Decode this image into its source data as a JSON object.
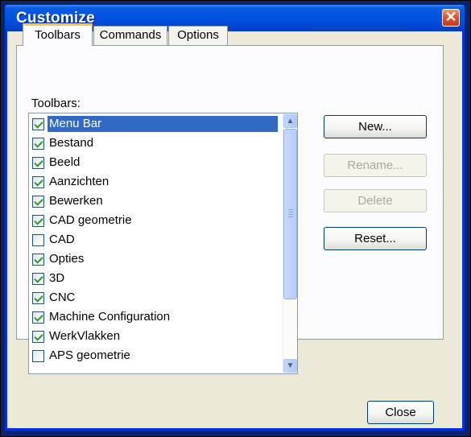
{
  "window": {
    "title": "Customize",
    "close_glyph": "✕"
  },
  "tabs": [
    {
      "label": "Toolbars",
      "active": true
    },
    {
      "label": "Commands",
      "active": false
    },
    {
      "label": "Options",
      "active": false
    }
  ],
  "toolbars_label": "Toolbars:",
  "toolbars": [
    {
      "label": "Menu Bar",
      "checked": true,
      "selected": true
    },
    {
      "label": "Bestand",
      "checked": true
    },
    {
      "label": "Beeld",
      "checked": true
    },
    {
      "label": "Aanzichten",
      "checked": true
    },
    {
      "label": "Bewerken",
      "checked": true
    },
    {
      "label": "CAD geometrie",
      "checked": true
    },
    {
      "label": "CAD",
      "checked": false
    },
    {
      "label": "Opties",
      "checked": true
    },
    {
      "label": "3D",
      "checked": true
    },
    {
      "label": "CNC",
      "checked": true
    },
    {
      "label": "Machine Configuration",
      "checked": true
    },
    {
      "label": "WerkVlakken",
      "checked": true
    },
    {
      "label": "APS geometrie",
      "checked": false
    }
  ],
  "buttons": {
    "new": "New...",
    "rename": "Rename...",
    "delete": "Delete",
    "reset": "Reset...",
    "close": "Close"
  },
  "scrollbar": {
    "up_glyph": "▲",
    "down_glyph": "▼"
  }
}
